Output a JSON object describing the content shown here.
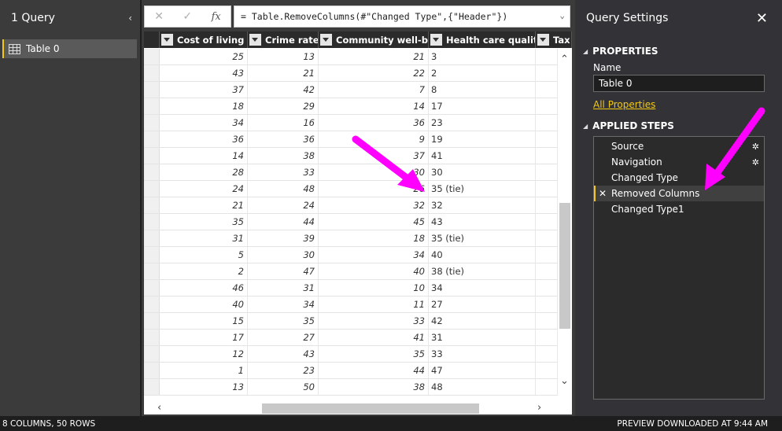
{
  "queries_pane": {
    "title": "1 Query",
    "collapse_glyph": "‹",
    "items": [
      {
        "label": "Table 0",
        "icon": "table-icon"
      }
    ]
  },
  "formula_bar": {
    "cancel_glyph": "✕",
    "commit_glyph": "✓",
    "fx_label": "fx",
    "formula": "= Table.RemoveColumns(#\"Changed Type\",{\"Header\"})",
    "expand_glyph": "⌄"
  },
  "columns": [
    "Cost of living",
    "Crime rate",
    "Community well-being",
    "Health care quality",
    "Tax rate"
  ],
  "rows": [
    [
      "25",
      "13",
      "21",
      "3"
    ],
    [
      "43",
      "21",
      "22",
      "2"
    ],
    [
      "37",
      "42",
      "7",
      "8"
    ],
    [
      "18",
      "29",
      "14",
      "17"
    ],
    [
      "34",
      "16",
      "36",
      "23"
    ],
    [
      "36",
      "36",
      "9",
      "19"
    ],
    [
      "14",
      "38",
      "37",
      "41"
    ],
    [
      "28",
      "33",
      "30",
      "30"
    ],
    [
      "24",
      "48",
      "26",
      "35 (tie)"
    ],
    [
      "21",
      "24",
      "32",
      "32"
    ],
    [
      "35",
      "44",
      "45",
      "43"
    ],
    [
      "31",
      "39",
      "18",
      "35 (tie)"
    ],
    [
      "5",
      "30",
      "34",
      "40"
    ],
    [
      "2",
      "47",
      "40",
      "38 (tie)"
    ],
    [
      "46",
      "31",
      "10",
      "34"
    ],
    [
      "40",
      "34",
      "11",
      "27"
    ],
    [
      "15",
      "35",
      "33",
      "42"
    ],
    [
      "17",
      "27",
      "41",
      "31"
    ],
    [
      "12",
      "43",
      "35",
      "33"
    ],
    [
      "1",
      "23",
      "44",
      "47"
    ],
    [
      "13",
      "50",
      "38",
      "48"
    ]
  ],
  "settings_pane": {
    "title": "Query Settings",
    "close_glyph": "✕",
    "properties_heading": "PROPERTIES",
    "name_label": "Name",
    "name_value": "Table 0",
    "all_properties_link": "All Properties",
    "applied_steps_heading": "APPLIED STEPS",
    "steps": [
      {
        "label": "Source",
        "has_gear": true
      },
      {
        "label": "Navigation",
        "has_gear": true
      },
      {
        "label": "Changed Type",
        "has_gear": false
      },
      {
        "label": "Removed Columns",
        "has_gear": false,
        "selected": true
      },
      {
        "label": "Changed Type1",
        "has_gear": false
      }
    ],
    "gear_glyph": "✲",
    "delete_glyph": "✕"
  },
  "status_bar": {
    "left": "8 COLUMNS, 50 ROWS",
    "right": "PREVIEW DOWNLOADED AT 9:44 AM"
  },
  "colors": {
    "accent": "#f2c811",
    "arrow": "#ff00ff",
    "dark_bg": "#3b3b3b",
    "status_bg": "#1e1e1e"
  }
}
